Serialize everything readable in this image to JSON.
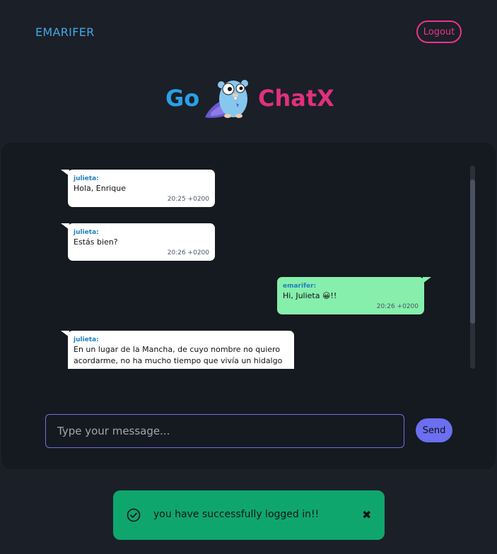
{
  "header": {
    "username": "EMARIFER",
    "logout_label": "Logout"
  },
  "logo": {
    "left_text": "Go",
    "right_text": "ChatX",
    "mascot_icon": "gopher-mascot-icon"
  },
  "messages": [
    {
      "author": "julieta:",
      "text": "Hola, Enrique",
      "time": "20:25 +0200",
      "direction": "in"
    },
    {
      "author": "julieta:",
      "text": "Estás bien?",
      "time": "20:26 +0200",
      "direction": "in"
    },
    {
      "author": "emarifer:",
      "text": "Hi, Julieta 😀!!",
      "time": "20:26 +0200",
      "direction": "out"
    },
    {
      "author": "julieta:",
      "text": "En un lugar de la Mancha, de cuyo nombre no quiero acordarme, no ha mucho tiempo que vivía un hidalgo de",
      "time": "",
      "direction": "in"
    }
  ],
  "composer": {
    "placeholder": "Type your message...",
    "send_label": "Send"
  },
  "toast": {
    "message": "you have successfully logged in!!",
    "status_icon": "check-circle-icon",
    "close_icon": "close-x-icon"
  },
  "colors": {
    "background": "#1b1f27",
    "panel": "#151920",
    "accent_blue": "#2aa0e6",
    "accent_pink": "#e0307e",
    "outgoing_bubble": "#86efac",
    "incoming_bubble": "#ffffff",
    "send_button": "#6b6ff0",
    "toast_success": "#0fa66e"
  }
}
